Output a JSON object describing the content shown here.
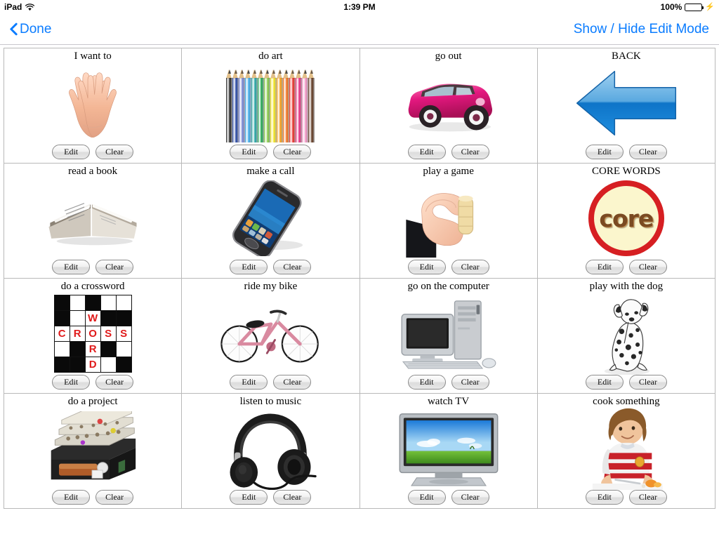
{
  "statusbar": {
    "device": "iPad",
    "wifi_icon": "wifi-icon",
    "time": "1:39 PM",
    "battery_percent": "100%",
    "battery_icon": "battery-icon",
    "charging_icon": "lightning-bolt-icon",
    "battery_color": "#4cd964"
  },
  "navbar": {
    "back_icon": "chevron-left-icon",
    "back_label": "Done",
    "edit_mode_label": "Show / Hide Edit Mode",
    "accent_color": "#0a7cff"
  },
  "buttons": {
    "edit_label": "Edit",
    "clear_label": "Clear"
  },
  "grid": {
    "columns": 4,
    "rows": 4,
    "cells": [
      {
        "label": "I want to",
        "art": "open-hands-image"
      },
      {
        "label": "do art",
        "art": "colored-pencils-image"
      },
      {
        "label": "go out",
        "art": "pink-car-image"
      },
      {
        "label": "BACK",
        "art": "blue-left-arrow-image"
      },
      {
        "label": "read a book",
        "art": "open-book-image"
      },
      {
        "label": "make a call",
        "art": "smartphone-image"
      },
      {
        "label": "play a game",
        "art": "hand-holding-game-piece-image"
      },
      {
        "label": "CORE WORDS",
        "art": "core-circle-image"
      },
      {
        "label": "do a crossword",
        "art": "crossword-grid-image"
      },
      {
        "label": "ride my bike",
        "art": "pink-bicycle-image"
      },
      {
        "label": "go on the computer",
        "art": "desktop-computer-image"
      },
      {
        "label": "play with the dog",
        "art": "dalmatian-dog-image"
      },
      {
        "label": "do a project",
        "art": "toolbox-image"
      },
      {
        "label": "listen to music",
        "art": "headphones-image"
      },
      {
        "label": "watch TV",
        "art": "flat-screen-tv-image"
      },
      {
        "label": "cook something",
        "art": "person-cooking-image"
      }
    ]
  },
  "core_circle": {
    "text": "core",
    "ring_color": "#d61f22",
    "fill_color": "#fbf6cd"
  },
  "crossword": {
    "letter_color": "#e01b1b",
    "rows": [
      [
        "b",
        "w",
        "b",
        "w",
        "w"
      ],
      [
        "b",
        "w",
        "W",
        "b",
        "b"
      ],
      [
        "C",
        "R",
        "O",
        "S",
        "S"
      ],
      [
        "w",
        "b",
        "R",
        "b",
        "w"
      ],
      [
        "b",
        "b",
        "D",
        "w",
        "b"
      ]
    ]
  },
  "pencil_colors": [
    "#1b1b1b",
    "#1f3fa0",
    "#6f7fd0",
    "#33a6e8",
    "#1aa0a0",
    "#18a24a",
    "#7ec63a",
    "#f2e317",
    "#f59b10",
    "#f26a11",
    "#e8241f",
    "#e5267a",
    "#f08fc0",
    "#5a3018"
  ]
}
